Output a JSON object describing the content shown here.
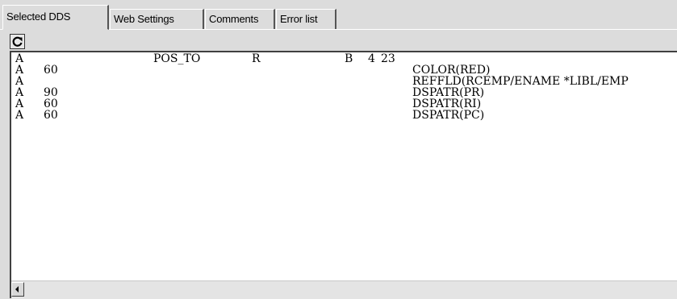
{
  "tabs": [
    {
      "label": "Selected DDS",
      "active": true
    },
    {
      "label": "Web Settings",
      "active": false
    },
    {
      "label": "Comments",
      "active": false
    },
    {
      "label": "Error list",
      "active": false
    }
  ],
  "toolbar": {
    "refresh_icon": "refresh-icon"
  },
  "editor": {
    "lines": [
      {
        "spec": "A",
        "ind": "",
        "name": "POS_TO",
        "ref": "R",
        "use": "B",
        "line": "4",
        "pos": "23",
        "kw": ""
      },
      {
        "spec": "A",
        "ind": "60",
        "name": "",
        "ref": "",
        "use": "",
        "line": "",
        "pos": "",
        "kw": "COLOR(RED)"
      },
      {
        "spec": "A",
        "ind": "",
        "name": "",
        "ref": "",
        "use": "",
        "line": "",
        "pos": "",
        "kw": "REFFLD(RCEMP/ENAME *LIBL/EMP"
      },
      {
        "spec": "A",
        "ind": "90",
        "name": "",
        "ref": "",
        "use": "",
        "line": "",
        "pos": "",
        "kw": "DSPATR(PR)"
      },
      {
        "spec": "A",
        "ind": "60",
        "name": "",
        "ref": "",
        "use": "",
        "line": "",
        "pos": "",
        "kw": "DSPATR(RI)"
      },
      {
        "spec": "A",
        "ind": "60",
        "name": "",
        "ref": "",
        "use": "",
        "line": "",
        "pos": "",
        "kw": "DSPATR(PC)"
      }
    ]
  },
  "scrollbar": {
    "left_arrow_icon": "left-arrow-icon"
  }
}
